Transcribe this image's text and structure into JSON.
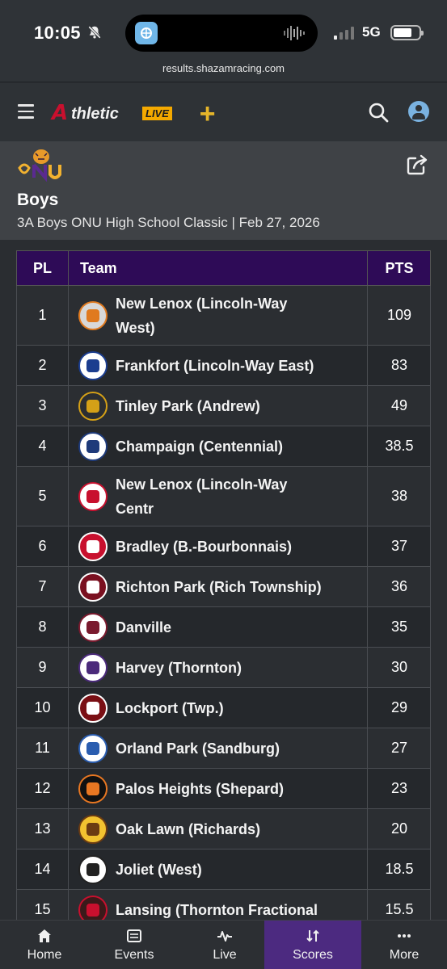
{
  "status_bar": {
    "time": "10:05",
    "network": "5G"
  },
  "browser": {
    "url": "results.shazamracing.com"
  },
  "app": {
    "brand_a": "A",
    "brand_text": "thletic",
    "brand_live": "LIVE",
    "plus": "+"
  },
  "meet": {
    "title": "Boys",
    "subtitle": "3A Boys ONU High School Classic | Feb 27, 2026"
  },
  "table": {
    "headers": {
      "place": "PL",
      "team": "Team",
      "points": "PTS"
    },
    "rows": [
      {
        "place": "1",
        "team": "New Lenox (Lincoln-Way West)",
        "points": "109",
        "logo_color": "#d8d8d8",
        "logo_accent": "#e07a1f",
        "lines": 2
      },
      {
        "place": "2",
        "team": "Frankfort (Lincoln-Way East)",
        "points": "83",
        "logo_color": "#ffffff",
        "logo_accent": "#1b3d8f",
        "lines": 1
      },
      {
        "place": "3",
        "team": "Tinley Park (Andrew)",
        "points": "49",
        "logo_color": "transparent",
        "logo_accent": "#d4a017",
        "lines": 1
      },
      {
        "place": "4",
        "team": "Champaign (Centennial)",
        "points": "38.5",
        "logo_color": "#ffffff",
        "logo_accent": "#1e3a7a",
        "lines": 1
      },
      {
        "place": "5",
        "team": "New Lenox (Lincoln-Way Centr",
        "points": "38",
        "logo_color": "#ffffff",
        "logo_accent": "#c8102e",
        "lines": 2
      },
      {
        "place": "6",
        "team": "Bradley (B.-Bourbonnais)",
        "points": "37",
        "logo_color": "#c8102e",
        "logo_accent": "#ffffff",
        "lines": 1
      },
      {
        "place": "7",
        "team": "Richton Park (Rich Township)",
        "points": "36",
        "logo_color": "#7a1020",
        "logo_accent": "#ffffff",
        "lines": 1
      },
      {
        "place": "8",
        "team": "Danville",
        "points": "35",
        "logo_color": "#ffffff",
        "logo_accent": "#7a1a2e",
        "lines": 1
      },
      {
        "place": "9",
        "team": "Harvey (Thornton)",
        "points": "30",
        "logo_color": "#ffffff",
        "logo_accent": "#4b2a7b",
        "lines": 1
      },
      {
        "place": "10",
        "team": "Lockport (Twp.)",
        "points": "29",
        "logo_color": "#7a0f14",
        "logo_accent": "#ffffff",
        "lines": 1
      },
      {
        "place": "11",
        "team": "Orland Park (Sandburg)",
        "points": "27",
        "logo_color": "#ffffff",
        "logo_accent": "#2a5db0",
        "lines": 1
      },
      {
        "place": "12",
        "team": "Palos Heights (Shepard)",
        "points": "23",
        "logo_color": "#111111",
        "logo_accent": "#e87722",
        "lines": 1
      },
      {
        "place": "13",
        "team": "Oak Lawn (Richards)",
        "points": "20",
        "logo_color": "#f2c230",
        "logo_accent": "#6b3b12",
        "lines": 1
      },
      {
        "place": "14",
        "team": "Joliet (West)",
        "points": "18.5",
        "logo_color": "#ffffff",
        "logo_accent": "#222222",
        "lines": 1
      },
      {
        "place": "15",
        "team": "Lansing (Thornton Fractional",
        "points": "15.5",
        "logo_color": "#3a1a1a",
        "logo_accent": "#c8102e",
        "lines": 1
      }
    ]
  },
  "nav": {
    "items": [
      {
        "label": "Home",
        "icon": "home-icon"
      },
      {
        "label": "Events",
        "icon": "list-icon"
      },
      {
        "label": "Live",
        "icon": "pulse-icon"
      },
      {
        "label": "Scores",
        "icon": "sort-icon"
      },
      {
        "label": "More",
        "icon": "more-icon"
      }
    ],
    "active": "Scores"
  },
  "colors": {
    "header_purple": "#2e0b57",
    "active_nav": "#4c2a80",
    "brand_red": "#c8102e",
    "brand_gold": "#f4a900"
  }
}
